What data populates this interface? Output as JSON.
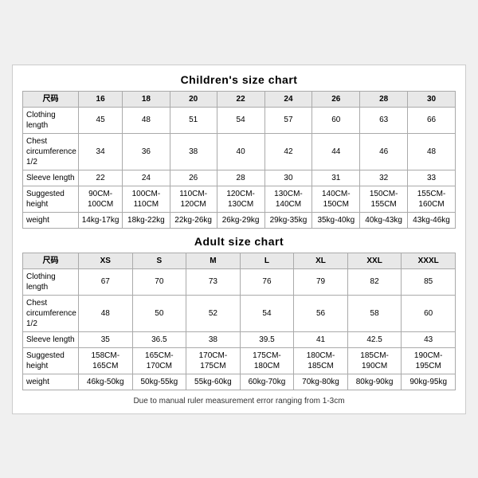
{
  "children_chart": {
    "title": "Children's size chart",
    "headers": [
      "尺码",
      "16",
      "18",
      "20",
      "22",
      "24",
      "26",
      "28",
      "30"
    ],
    "rows": [
      {
        "label": "Clothing length",
        "values": [
          "45",
          "48",
          "51",
          "54",
          "57",
          "60",
          "63",
          "66"
        ]
      },
      {
        "label": "Chest circumference 1/2",
        "values": [
          "34",
          "36",
          "38",
          "40",
          "42",
          "44",
          "46",
          "48"
        ]
      },
      {
        "label": "Sleeve length",
        "values": [
          "22",
          "24",
          "26",
          "28",
          "30",
          "31",
          "32",
          "33"
        ]
      },
      {
        "label": "Suggested height",
        "values": [
          "90CM-100CM",
          "100CM-110CM",
          "110CM-120CM",
          "120CM-130CM",
          "130CM-140CM",
          "140CM-150CM",
          "150CM-155CM",
          "155CM-160CM"
        ]
      },
      {
        "label": "weight",
        "values": [
          "14kg-17kg",
          "18kg-22kg",
          "22kg-26kg",
          "26kg-29kg",
          "29kg-35kg",
          "35kg-40kg",
          "40kg-43kg",
          "43kg-46kg"
        ]
      }
    ]
  },
  "adult_chart": {
    "title": "Adult size chart",
    "headers": [
      "尺码",
      "XS",
      "S",
      "M",
      "L",
      "XL",
      "XXL",
      "XXXL"
    ],
    "rows": [
      {
        "label": "Clothing length",
        "values": [
          "67",
          "70",
          "73",
          "76",
          "79",
          "82",
          "85"
        ]
      },
      {
        "label": "Chest circumference 1/2",
        "values": [
          "48",
          "50",
          "52",
          "54",
          "56",
          "58",
          "60"
        ]
      },
      {
        "label": "Sleeve length",
        "values": [
          "35",
          "36.5",
          "38",
          "39.5",
          "41",
          "42.5",
          "43"
        ]
      },
      {
        "label": "Suggested height",
        "values": [
          "158CM-165CM",
          "165CM-170CM",
          "170CM-175CM",
          "175CM-180CM",
          "180CM-185CM",
          "185CM-190CM",
          "190CM-195CM"
        ]
      },
      {
        "label": "weight",
        "values": [
          "46kg-50kg",
          "50kg-55kg",
          "55kg-60kg",
          "60kg-70kg",
          "70kg-80kg",
          "80kg-90kg",
          "90kg-95kg"
        ]
      }
    ]
  },
  "note": "Due to manual ruler measurement error ranging from 1-3cm"
}
